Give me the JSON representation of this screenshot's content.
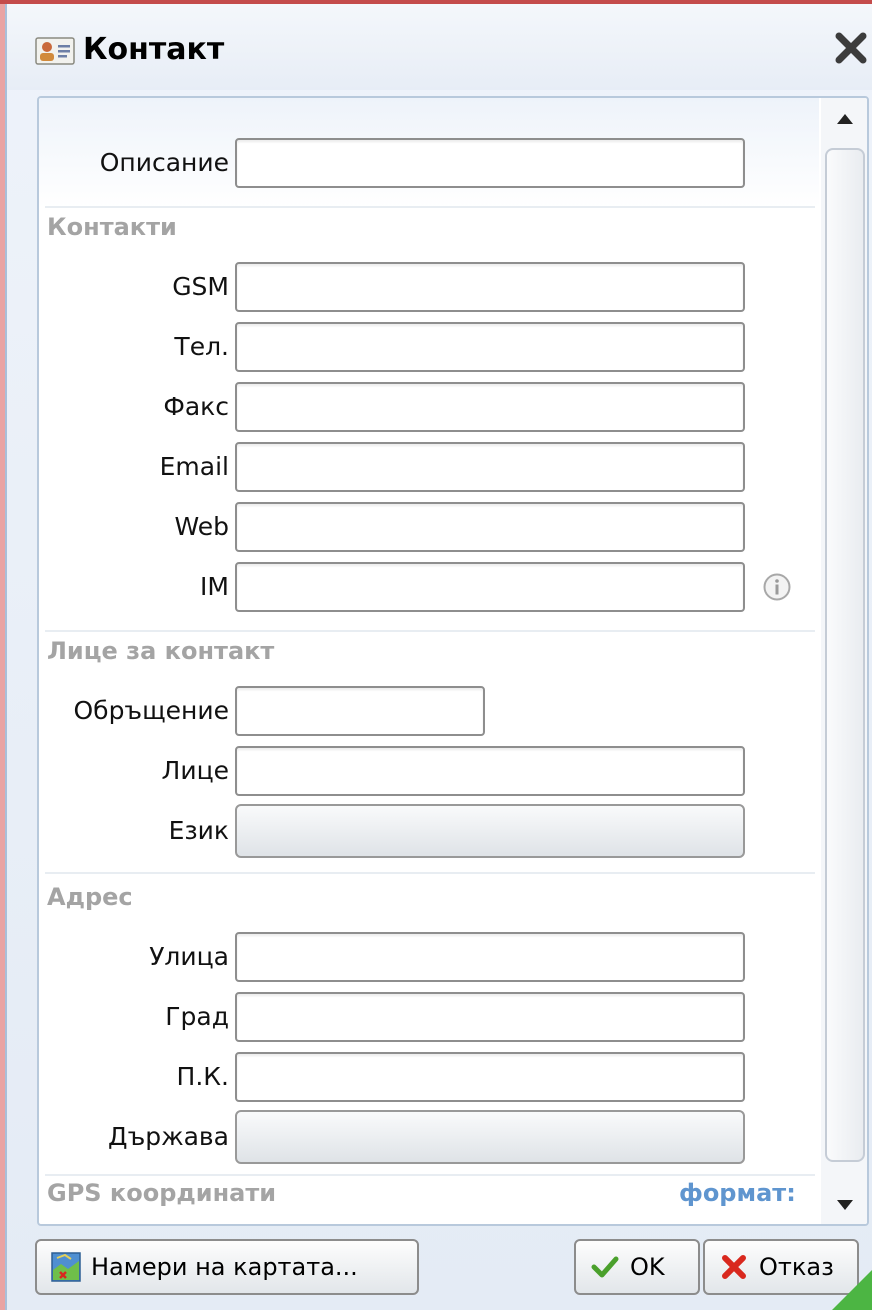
{
  "window": {
    "title": "Контакт"
  },
  "form": {
    "description": {
      "label": "Описание",
      "value": ""
    },
    "contacts": {
      "section_title": "Контакти",
      "gsm": {
        "label": "GSM",
        "value": ""
      },
      "phone": {
        "label": "Тел.",
        "value": ""
      },
      "fax": {
        "label": "Факс",
        "value": ""
      },
      "email": {
        "label": "Email",
        "value": ""
      },
      "web": {
        "label": "Web",
        "value": ""
      },
      "im": {
        "label": "IM",
        "value": ""
      }
    },
    "contact_person": {
      "section_title": "Лице за контакт",
      "salutation": {
        "label": "Обръщение",
        "value": ""
      },
      "person": {
        "label": "Лице",
        "value": ""
      },
      "language": {
        "label": "Език",
        "value": ""
      }
    },
    "address": {
      "section_title": "Адрес",
      "street": {
        "label": "Улица",
        "value": ""
      },
      "city": {
        "label": "Град",
        "value": ""
      },
      "postcode": {
        "label": "П.К.",
        "value": ""
      },
      "country": {
        "label": "Държава",
        "value": ""
      }
    },
    "gps": {
      "section_title": "GPS координати",
      "format_link": "формат:"
    }
  },
  "buttons": {
    "find_on_map": "Намери на картата...",
    "ok": "OK",
    "cancel": "Отказ"
  },
  "icons": {
    "title": "contact-card-icon",
    "close": "close-icon",
    "info": "info-icon",
    "map": "map-icon",
    "ok": "checkmark-icon",
    "cancel": "red-x-icon"
  },
  "colors": {
    "section_title": "#a4a4a4",
    "link": "#5f95cf",
    "ok_check": "#4aa02c",
    "cancel_x": "#d9281e"
  }
}
